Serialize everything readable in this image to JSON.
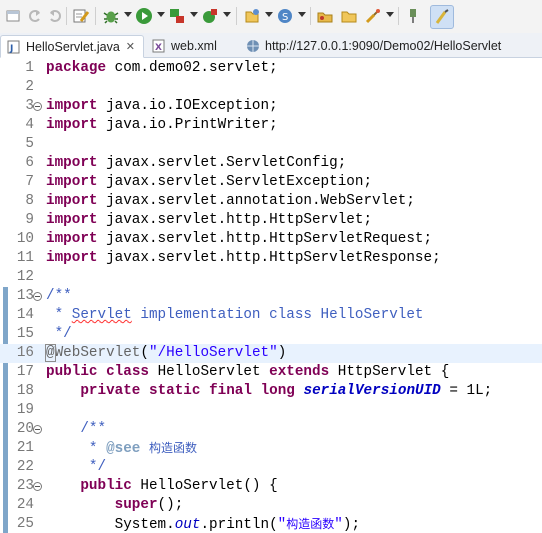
{
  "colors": {
    "keyword": "#7f0055",
    "comment": "#3f5fbf",
    "string": "#2a00ff",
    "annotation": "#646464",
    "field": "#0000c0",
    "line_highlight": "#e8f2fe"
  },
  "toolbar": {
    "icons": [
      "window-icon",
      "back-icon",
      "forward-icon",
      "tasks-icon",
      "debug-icon",
      "run-icon",
      "coverage-icon",
      "external-tools-icon",
      "new-icon",
      "open-type-icon",
      "open-folder-icon",
      "search-icon",
      "pin-icon",
      "highlight-icon"
    ]
  },
  "tabs": [
    {
      "label": "HelloServlet.java",
      "close": "✕"
    },
    {
      "label": "web.xml"
    },
    {
      "label": "http://127.0.0.1:9090/Demo02/HelloServlet"
    }
  ],
  "editor": {
    "lines": [
      {
        "n": "1",
        "s": [
          {
            "t": "package",
            "c": "kw"
          },
          {
            "t": " com.demo02.servlet;"
          }
        ]
      },
      {
        "n": "2",
        "s": []
      },
      {
        "n": "3",
        "fold": true,
        "s": [
          {
            "t": "import",
            "c": "kw"
          },
          {
            "t": " java.io.IOException;"
          }
        ]
      },
      {
        "n": "4",
        "s": [
          {
            "t": "import",
            "c": "kw"
          },
          {
            "t": " java.io.PrintWriter;"
          }
        ]
      },
      {
        "n": "5",
        "s": []
      },
      {
        "n": "6",
        "s": [
          {
            "t": "import",
            "c": "kw"
          },
          {
            "t": " javax.servlet.ServletConfig;"
          }
        ]
      },
      {
        "n": "7",
        "s": [
          {
            "t": "import",
            "c": "kw"
          },
          {
            "t": " javax.servlet.ServletException;"
          }
        ]
      },
      {
        "n": "8",
        "s": [
          {
            "t": "import",
            "c": "kw"
          },
          {
            "t": " javax.servlet.annotation.WebServlet;"
          }
        ]
      },
      {
        "n": "9",
        "s": [
          {
            "t": "import",
            "c": "kw"
          },
          {
            "t": " javax.servlet.http.HttpServlet;"
          }
        ]
      },
      {
        "n": "10",
        "s": [
          {
            "t": "import",
            "c": "kw"
          },
          {
            "t": " javax.servlet.http.HttpServletRequest;"
          }
        ]
      },
      {
        "n": "11",
        "s": [
          {
            "t": "import",
            "c": "kw"
          },
          {
            "t": " javax.servlet.http.HttpServletResponse;"
          }
        ]
      },
      {
        "n": "12",
        "s": []
      },
      {
        "n": "13",
        "fold": true,
        "s": [
          {
            "t": "/**",
            "c": "cm"
          }
        ]
      },
      {
        "n": "14",
        "s": [
          {
            "t": " * ",
            "c": "cm"
          },
          {
            "t": "Servlet",
            "c": "cm spell"
          },
          {
            "t": " implementation class HelloServlet",
            "c": "cm"
          }
        ]
      },
      {
        "n": "15",
        "s": [
          {
            "t": " */",
            "c": "cm"
          }
        ]
      },
      {
        "n": "16",
        "hl": true,
        "s": [
          {
            "t": "@",
            "c": "ann sel-ann"
          },
          {
            "t": "WebServlet",
            "c": "ann"
          },
          {
            "t": "("
          },
          {
            "t": "\"/HelloServlet\"",
            "c": "st"
          },
          {
            "t": ")"
          }
        ]
      },
      {
        "n": "17",
        "s": [
          {
            "t": "public",
            "c": "kw"
          },
          {
            "t": " "
          },
          {
            "t": "class",
            "c": "kw"
          },
          {
            "t": " HelloServlet "
          },
          {
            "t": "extends",
            "c": "kw"
          },
          {
            "t": " HttpServlet {"
          }
        ]
      },
      {
        "n": "18",
        "s": [
          {
            "t": "    "
          },
          {
            "t": "private",
            "c": "kw"
          },
          {
            "t": " "
          },
          {
            "t": "static",
            "c": "kw"
          },
          {
            "t": " "
          },
          {
            "t": "final",
            "c": "kw"
          },
          {
            "t": " "
          },
          {
            "t": "long",
            "c": "kw"
          },
          {
            "t": " "
          },
          {
            "t": "serialVersionUID",
            "c": "fld"
          },
          {
            "t": " = 1L;"
          }
        ]
      },
      {
        "n": "19",
        "s": []
      },
      {
        "n": "20",
        "fold": true,
        "s": [
          {
            "t": "    "
          },
          {
            "t": "/**",
            "c": "cm"
          }
        ]
      },
      {
        "n": "21",
        "s": [
          {
            "t": "     * ",
            "c": "cm"
          },
          {
            "t": "@see",
            "c": "tag"
          },
          {
            "t": " ",
            "c": "cm"
          },
          {
            "t": "构造函数",
            "c": "cm cjk"
          }
        ]
      },
      {
        "n": "22",
        "s": [
          {
            "t": "     */",
            "c": "cm"
          }
        ]
      },
      {
        "n": "23",
        "fold": true,
        "s": [
          {
            "t": "    "
          },
          {
            "t": "public",
            "c": "kw"
          },
          {
            "t": " HelloServlet() {"
          }
        ]
      },
      {
        "n": "24",
        "s": [
          {
            "t": "        "
          },
          {
            "t": "super",
            "c": "kw"
          },
          {
            "t": "();"
          }
        ]
      },
      {
        "n": "25",
        "s": [
          {
            "t": "        System."
          },
          {
            "t": "out",
            "c": "sfld"
          },
          {
            "t": ".println("
          },
          {
            "t": "\"",
            "c": "st"
          },
          {
            "t": "构造函数",
            "c": "st cjk"
          },
          {
            "t": "\"",
            "c": "st"
          },
          {
            "t": ");"
          }
        ]
      }
    ]
  }
}
